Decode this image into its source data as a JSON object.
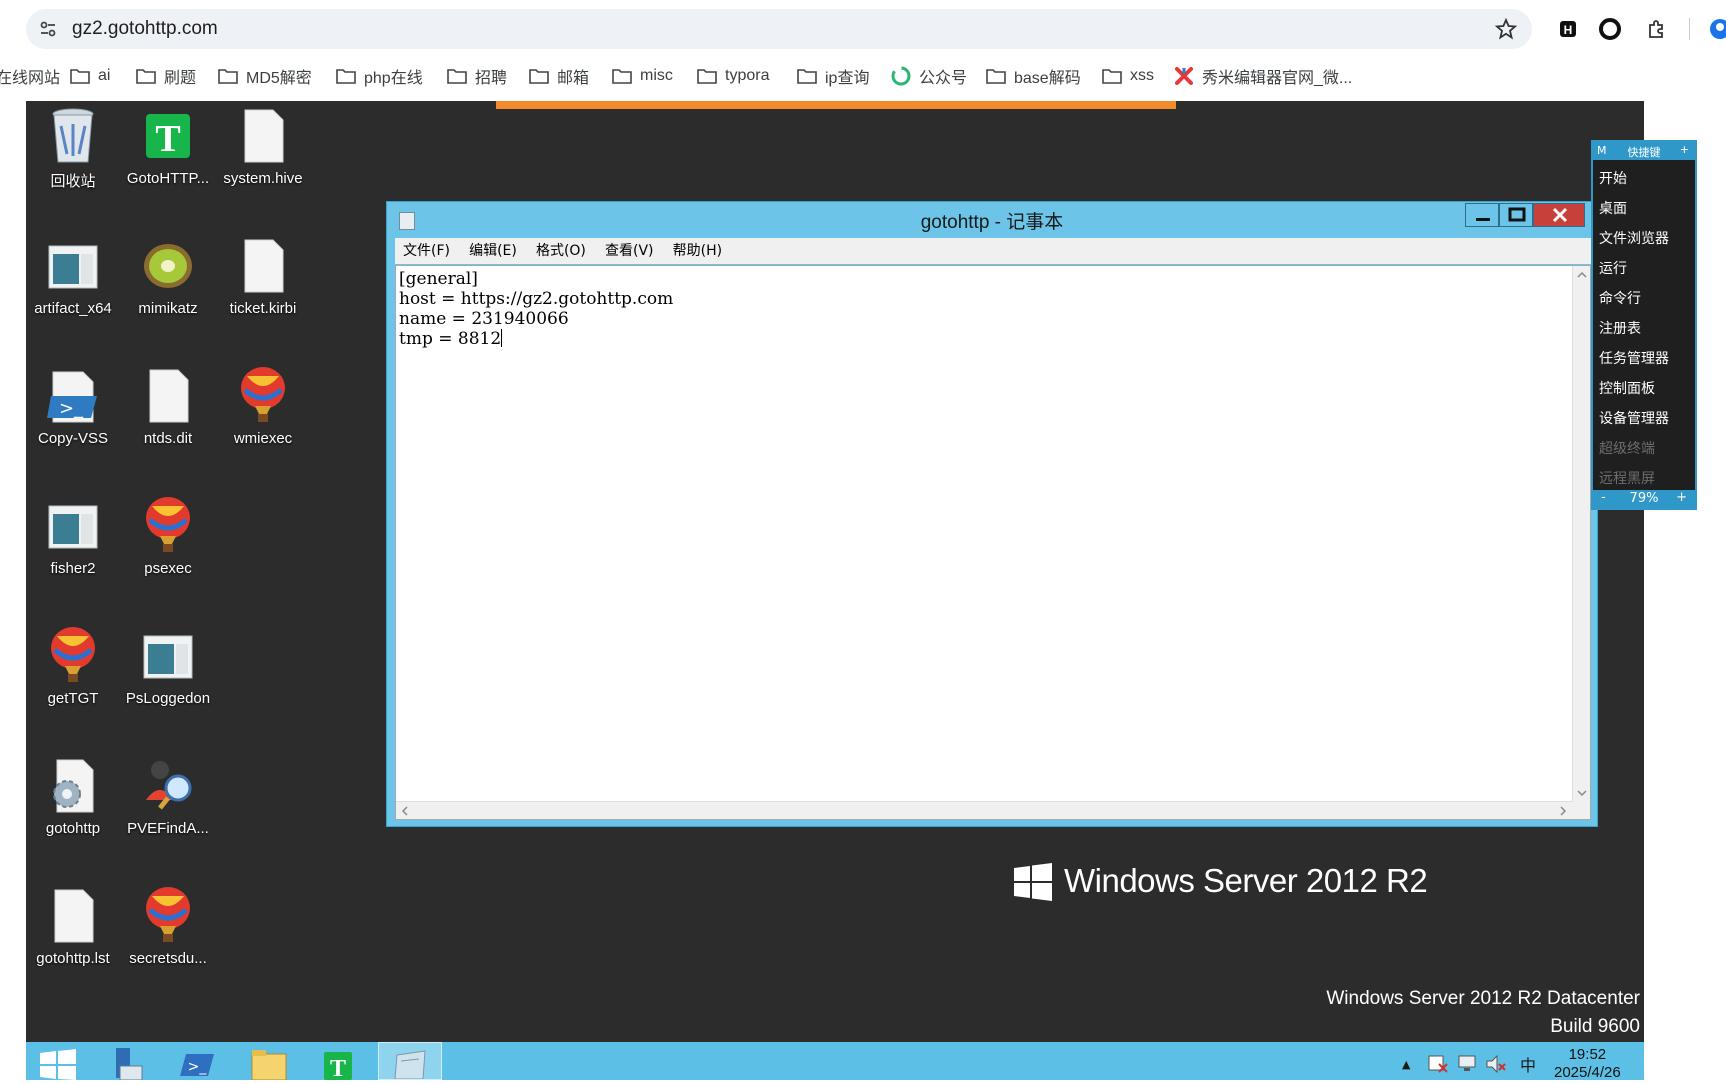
{
  "browser": {
    "url": "gz2.gotohttp.com",
    "bookmarks": [
      "在线网站",
      "ai",
      "刷题",
      "MD5解密",
      "php在线",
      "招聘",
      "邮箱",
      "misc",
      "typora",
      "ip查询",
      "公众号",
      "base解码",
      "xss",
      "秀米编辑器官网_微..."
    ]
  },
  "desktop": {
    "icons": [
      {
        "label": "回收站",
        "kind": "recycle-bin"
      },
      {
        "label": "GotoHTTP...",
        "kind": "gotohttp-app"
      },
      {
        "label": "system.hive",
        "kind": "file"
      },
      {
        "label": "artifact_x64",
        "kind": "app-window"
      },
      {
        "label": "mimikatz",
        "kind": "kiwi"
      },
      {
        "label": "ticket.kirbi",
        "kind": "file"
      },
      {
        "label": "Copy-VSS",
        "kind": "powershell-script"
      },
      {
        "label": "ntds.dit",
        "kind": "file"
      },
      {
        "label": "wmiexec",
        "kind": "balloon"
      },
      {
        "label": "fisher2",
        "kind": "app-window"
      },
      {
        "label": "psexec",
        "kind": "balloon"
      },
      {
        "label": "getTGT",
        "kind": "balloon"
      },
      {
        "label": "PsLoggedon",
        "kind": "app-window"
      },
      {
        "label": "gotohttp",
        "kind": "settings-file"
      },
      {
        "label": "PVEFindA...",
        "kind": "user-search"
      },
      {
        "label": "gotohttp.lst",
        "kind": "file"
      },
      {
        "label": "secretsdu...",
        "kind": "balloon"
      }
    ]
  },
  "notepad": {
    "title": "gotohttp - 记事本",
    "menu": [
      "文件(F)",
      "编辑(E)",
      "格式(O)",
      "查看(V)",
      "帮助(H)"
    ],
    "lines": [
      "[general]",
      "host = https://gz2.gotohttp.com",
      "name = 231940066",
      "tmp = 8812"
    ]
  },
  "quick_keys": {
    "header_m": "M",
    "title": "快捷键",
    "header_plus": "+",
    "items": [
      "开始",
      "桌面",
      "文件浏览器",
      "运行",
      "命令行",
      "注册表",
      "任务管理器",
      "控制面板",
      "设备管理器"
    ],
    "disabled_items": [
      "超级终端",
      "远程黑屏"
    ],
    "zoom_minus": "-",
    "zoom": "79%",
    "zoom_plus": "+"
  },
  "watermark": {
    "brand": "Windows Server 2012 R2",
    "edition": "Windows Server 2012 R2 Datacenter",
    "build": "Build 9600"
  },
  "taskbar": {
    "time": "19:52",
    "date": "2025/4/26",
    "ime": "中",
    "tray_up": "▲"
  },
  "colors": {
    "accent": "#5cc0e6",
    "orange_bar": "#f38b2b",
    "close_button": "#c7403a",
    "desktop_bg": "#2c2c2c"
  }
}
